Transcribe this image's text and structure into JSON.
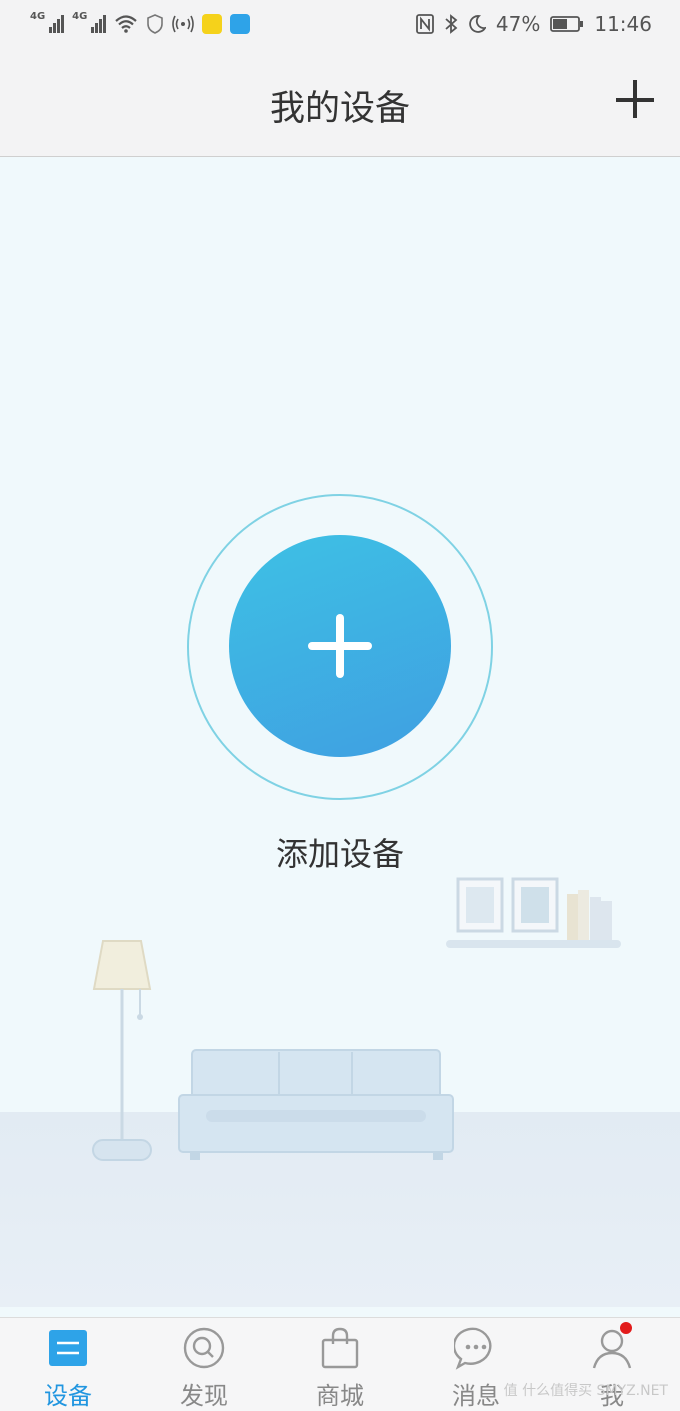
{
  "status": {
    "net1": "4G",
    "net2": "4G",
    "battery": "47%",
    "time": "11:46"
  },
  "header": {
    "title": "我的设备"
  },
  "main": {
    "add_label": "添加设备"
  },
  "tabs": [
    {
      "label": "设备",
      "icon": "devices-icon",
      "active": true
    },
    {
      "label": "发现",
      "icon": "search-icon",
      "active": false
    },
    {
      "label": "商城",
      "icon": "shopping-bag-icon",
      "active": false
    },
    {
      "label": "消息",
      "icon": "message-icon",
      "active": false
    },
    {
      "label": "我",
      "icon": "person-icon",
      "active": false
    }
  ],
  "watermark": "值 什么值得买 SMYZ.NET",
  "colors": {
    "accent": "#2196e0",
    "button": "#3ec1e4",
    "badge": "#e21b1b"
  }
}
